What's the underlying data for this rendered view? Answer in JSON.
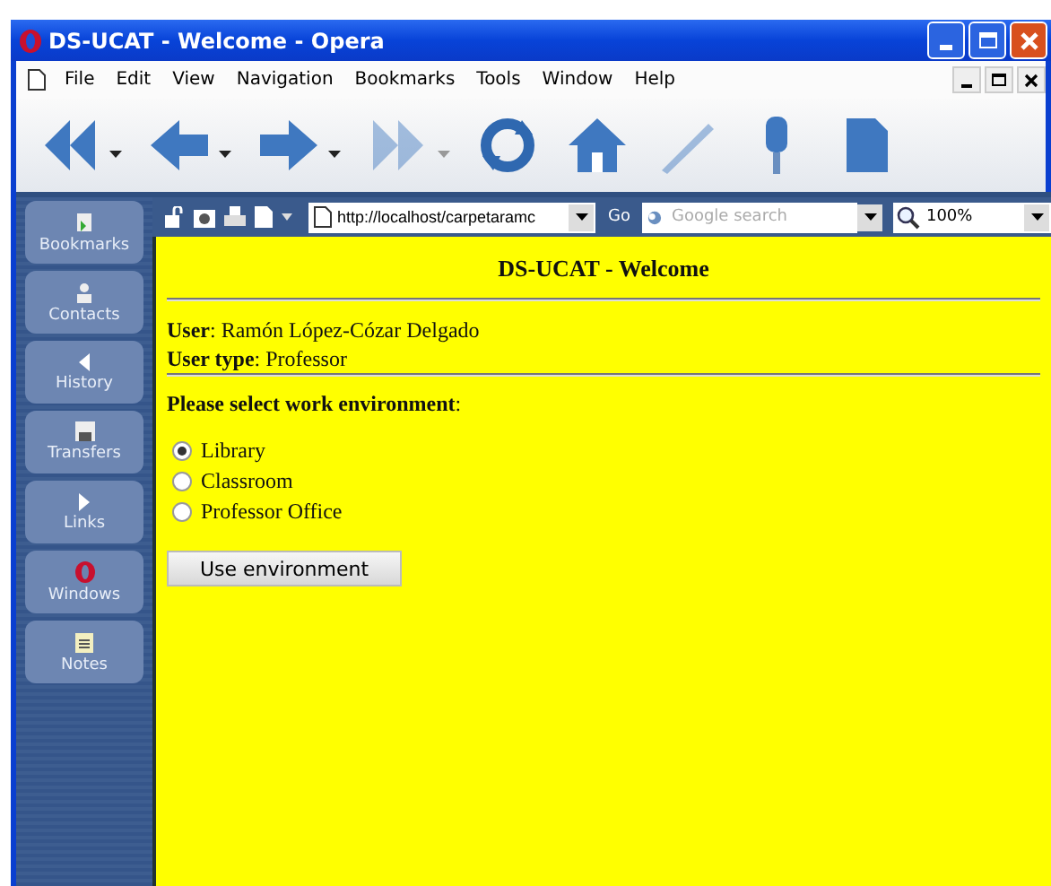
{
  "window": {
    "title": "DS-UCAT - Welcome - Opera"
  },
  "menu": [
    "File",
    "Edit",
    "View",
    "Navigation",
    "Bookmarks",
    "Tools",
    "Window",
    "Help"
  ],
  "toolbar": [
    {
      "kind": "rewind",
      "disabled": false
    },
    {
      "kind": "back",
      "disabled": false
    },
    {
      "kind": "forward",
      "disabled": false
    },
    {
      "kind": "fastforward",
      "disabled": true
    },
    {
      "kind": "reload",
      "disabled": false
    },
    {
      "kind": "home",
      "disabled": false
    },
    {
      "kind": "pen",
      "disabled": true
    },
    {
      "kind": "microphone",
      "disabled": false
    },
    {
      "kind": "page",
      "disabled": false
    }
  ],
  "address_bar": {
    "url": "http://localhost/carpetaramc",
    "go": "Go",
    "search_placeholder": "Google search",
    "zoom": "100%"
  },
  "sidebar": [
    {
      "label": "Bookmarks",
      "kind": "bookmarks"
    },
    {
      "label": "Contacts",
      "kind": "contacts"
    },
    {
      "label": "History",
      "kind": "history"
    },
    {
      "label": "Transfers",
      "kind": "transfers"
    },
    {
      "label": "Links",
      "kind": "links"
    },
    {
      "label": "Windows",
      "kind": "windows"
    },
    {
      "label": "Notes",
      "kind": "notes"
    }
  ],
  "page": {
    "heading": "DS-UCAT - Welcome",
    "user": "**User**: Ramón López-Cózar Delgado",
    "user_type": "**User type**: Professor",
    "prompt": "**Please select work environment**:",
    "options": [
      {
        "label": "Library",
        "selected": true
      },
      {
        "label": "Classroom",
        "selected": false
      },
      {
        "label": "Professor Office",
        "selected": false
      }
    ],
    "button": "Use environment"
  }
}
